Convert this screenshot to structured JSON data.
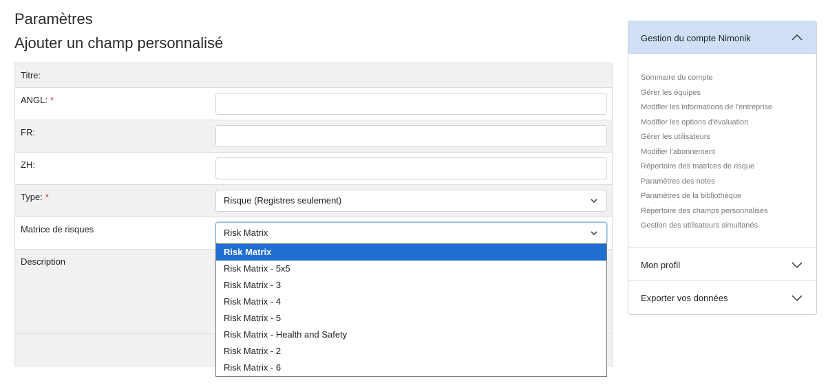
{
  "header": {
    "title": "Paramètres",
    "subtitle": "Ajouter un champ personnalisé"
  },
  "form": {
    "title_label": "Titre:",
    "angl_label": "ANGL:",
    "fr_label": "FR:",
    "zh_label": "ZH:",
    "type_label": "Type:",
    "type_value": "Risque (Registres seulement)",
    "matrix_label": "Matrice de risques",
    "matrix_value": "Risk Matrix",
    "description_label": "Description",
    "required_marker": "*"
  },
  "matrix_dropdown": {
    "options": [
      "Risk Matrix",
      "Risk Matrix - 5x5",
      "Risk Matrix - 3",
      "Risk Matrix - 4",
      "Risk Matrix - 5",
      "Risk Matrix - Health and Safety",
      "Risk Matrix - 2",
      "Risk Matrix - 6"
    ],
    "selected_index": 0
  },
  "sidebar": {
    "account_header": "Gestion du compte Nimonik",
    "account_links": [
      "Sommaire du compte",
      "Gérer les équipes",
      "Modifier les informations de l'entreprise",
      "Modifier les options d'évaluation",
      "Gérer les utilisateurs",
      "Modifier l'abonnement",
      "Répertoire des matrices de risque",
      "Paramètres des notes",
      "Paramètres de la bibliothèque",
      "Répertoire des champs personnalisés",
      "Gestion des utilisateurs simultanés"
    ],
    "profile_label": "Mon profil",
    "export_label": "Exporter vos données"
  },
  "colors": {
    "accent": "#1f6fd0",
    "sidebar_header_bg": "#cfe0f6",
    "required": "#d9272e"
  }
}
